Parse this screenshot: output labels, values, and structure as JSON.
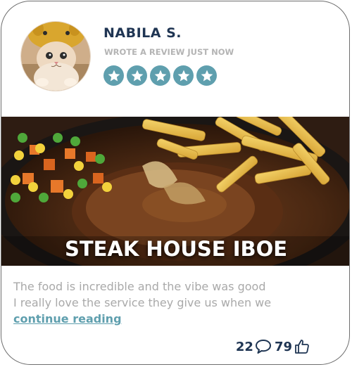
{
  "user": {
    "name": "NABILA S.",
    "subtitle": "WROTE A REVIEW JUST NOW",
    "rating": 5,
    "avatar_icon": "cat-avatar-icon"
  },
  "restaurant": {
    "name": "STEAK HOUSE IBOE"
  },
  "review": {
    "line1": "The food is incredible and the vibe was good",
    "line2": "I really love the service they give us when we",
    "continue_label": "continue reading"
  },
  "stats": {
    "comments": "22",
    "likes": "79",
    "comment_icon": "speech-bubble-icon",
    "like_icon": "thumbs-up-icon"
  },
  "colors": {
    "accent": "#5f9fae",
    "name": "#1f3553",
    "muted": "#a9a9a9"
  }
}
